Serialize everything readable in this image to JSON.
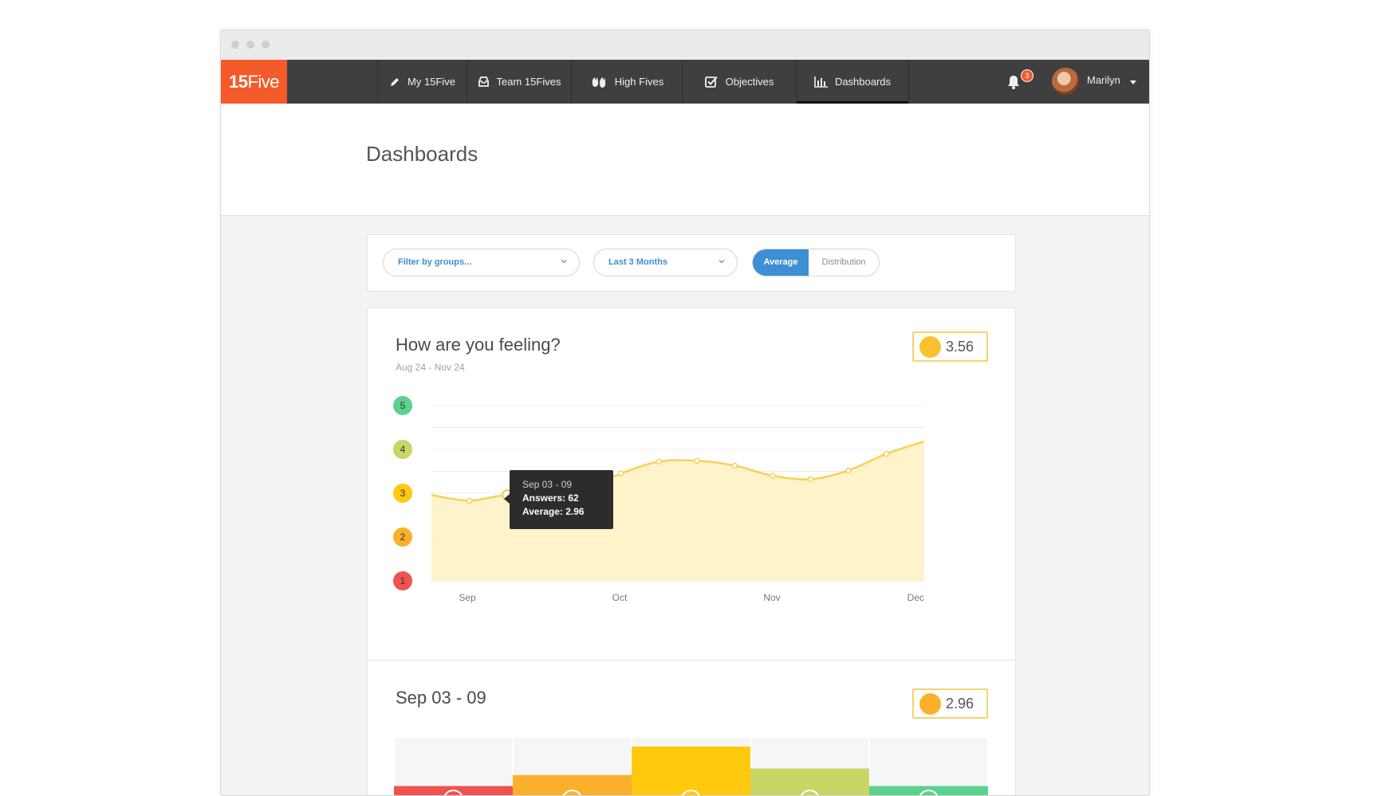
{
  "logo": {
    "bold": "15",
    "rest": "Five"
  },
  "nav": {
    "items": [
      {
        "label": "My 15Five",
        "icon": "pencil-icon"
      },
      {
        "label": "Team 15Fives",
        "icon": "inbox-icon"
      },
      {
        "label": "High Fives",
        "icon": "high-five-icon"
      },
      {
        "label": "Objectives",
        "icon": "checkbox-icon"
      },
      {
        "label": "Dashboards",
        "icon": "bar-chart-icon",
        "active": true
      }
    ],
    "notifications": "3",
    "user": "Marilyn"
  },
  "page": {
    "title": "Dashboards"
  },
  "filters": {
    "group_placeholder": "Filter by groups...",
    "range": "Last 3 Months",
    "toggle": [
      "Average",
      "Distribution"
    ],
    "active_toggle": "Average"
  },
  "feeling_card": {
    "title": "How are you feeling?",
    "subtitle": "Aug 24 - Nov 24",
    "score": "3.56"
  },
  "tooltip": {
    "date": "Sep 03 - 09",
    "answers": "Answers: 62",
    "average": "Average: 2.96"
  },
  "week_card": {
    "title": "Sep 03 - 09",
    "score": "2.96"
  },
  "colors": {
    "brand": "#f45a2a",
    "nav_bg": "#3f3f3f",
    "accent_blue": "#3d8fd3",
    "line": "#f8d15a",
    "area": "#fef1c1",
    "level_1": "#ef5350",
    "level_2": "#fbb02c",
    "level_3": "#ffc90e",
    "level_4": "#c9d564",
    "level_5": "#5cd18f"
  },
  "chart_data": [
    {
      "type": "area",
      "title": "How are you feeling?",
      "subtitle": "Aug 24 - Nov 24",
      "x_ticks": [
        "Sep",
        "Oct",
        "Nov",
        "Dec"
      ],
      "y_ticks": [
        "1",
        "2",
        "3",
        "4",
        "5"
      ],
      "ylim": [
        1,
        5
      ],
      "x": [
        0,
        1,
        2,
        3,
        4,
        5,
        6,
        7,
        8,
        9,
        10,
        11,
        12,
        13
      ],
      "series": [
        {
          "values": [
            2.96,
            2.83,
            2.96,
            2.88,
            3.1,
            3.45,
            3.72,
            3.74,
            3.63,
            3.4,
            3.32,
            3.52,
            3.9,
            4.18
          ]
        }
      ],
      "highlight_index": 2,
      "grid": true
    },
    {
      "type": "bar",
      "title": "Sep 03 - 09",
      "categories": [
        "1",
        "2",
        "3",
        "4",
        "5"
      ],
      "values": [
        0.12,
        0.22,
        0.48,
        0.28,
        0.12
      ]
    }
  ]
}
